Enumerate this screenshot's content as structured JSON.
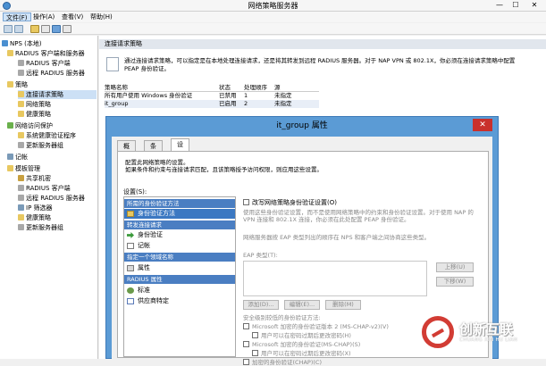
{
  "window": {
    "title": "网络策略服务器",
    "min": "—",
    "max": "☐",
    "close": "✕"
  },
  "menu": [
    "文件(F)",
    "操作(A)",
    "查看(V)",
    "帮助(H)"
  ],
  "tree": {
    "root": "NPS (本地)",
    "radius_group": "RADIUS 客户端和服务器",
    "radius_client": "RADIUS 客户端",
    "remote_radius": "远程 RADIUS 服务器",
    "policies": "策略",
    "conn_req": "连接请求策略",
    "network_policy": "网络策略",
    "health_policy": "健康策略",
    "nap": "网络访问保护",
    "shv": "系统健康验证程序",
    "remediation": "更新服务器组",
    "accounting": "记帐",
    "templates": "模板管理",
    "shared_secret": "共享机密",
    "t_radius_client": "RADIUS 客户端",
    "t_remote_radius": "远程 RADIUS 服务器",
    "ip_filter": "IP 筛选器",
    "t_health": "健康策略",
    "t_remediation": "更新服务器组"
  },
  "right": {
    "header": "连接请求策略",
    "description": "通过连接请求策略，可以指定是在本地处理连接请求，还是将其转发到远程 RADIUS 服务器。对于 NAP VPN 或 802.1X，你必须在连接请求策略中配置 PEAP 身份验证。",
    "columns": [
      "策略名称",
      "状态",
      "处理顺序",
      "源"
    ],
    "rows": [
      [
        "所有用户使用 Windows 身份验证",
        "已禁用",
        "1",
        "未指定"
      ],
      [
        "it_group",
        "已启用",
        "2",
        "未指定"
      ]
    ]
  },
  "dialog": {
    "title": "it_group 属性",
    "close": "✕",
    "tabs": [
      "概述",
      "条件",
      "设置"
    ],
    "intro": "配置此网络策略的设置。\n如果条件和约束与连接请求匹配，且该策略授予访问权限，则应用这些设置。",
    "settings_label": "设置(S):",
    "sections": {
      "required": "所需的身份验证方法",
      "forward": "转发连接请求",
      "attr": "指定一个领域名称",
      "radius_attr": "RADIUS 属性"
    },
    "items": {
      "auth_method": "身份验证方法",
      "auth": "身份验证",
      "accounting": "记帐",
      "attribute": "属性",
      "standard": "标准",
      "vendor": "供应商特定"
    },
    "override_label": "改写网络策略身份验证设置(O)",
    "override_desc": "使用这些身份验证设置，而不是使用网络策略中的约束和身份验证设置。对于使用 NAP 的 VPN 连接和 802.1X 连接，你必须在此处配置 PEAP 身份验证。",
    "eap_desc": "网络服务器按 EAP 类型列出的顺序在 NPS 和客户端之间协商这些类型。",
    "eap_types": "EAP 类型(T):",
    "btn_up": "上移(U)",
    "btn_down": "下移(W)",
    "btn_add": "添加(D)...",
    "btn_edit": "编辑(E)...",
    "btn_remove": "删除(M)",
    "less_secure": "安全级别较低的身份验证方法:",
    "ms_chap_v2": "Microsoft 加密的身份验证版本 2 (MS-CHAP-v2)(V)",
    "ms_chap_v2_pw": "用户可以在密码过期后更改密码(H)",
    "ms_chap": "Microsoft 加密的身份验证(MS-CHAP)(S)",
    "ms_chap_pw": "用户可以在密码过期后更改密码(X)",
    "chap": "加密的身份验证(CHAP)(C)"
  },
  "watermark": {
    "title": "创新互联",
    "subtitle": "CHUANG XIN HU LIAN"
  },
  "colors": {
    "accent": "#3b78c2",
    "section": "#4a7ec2",
    "dialog_frame": "#5b9bd5",
    "close": "#c9302c"
  }
}
